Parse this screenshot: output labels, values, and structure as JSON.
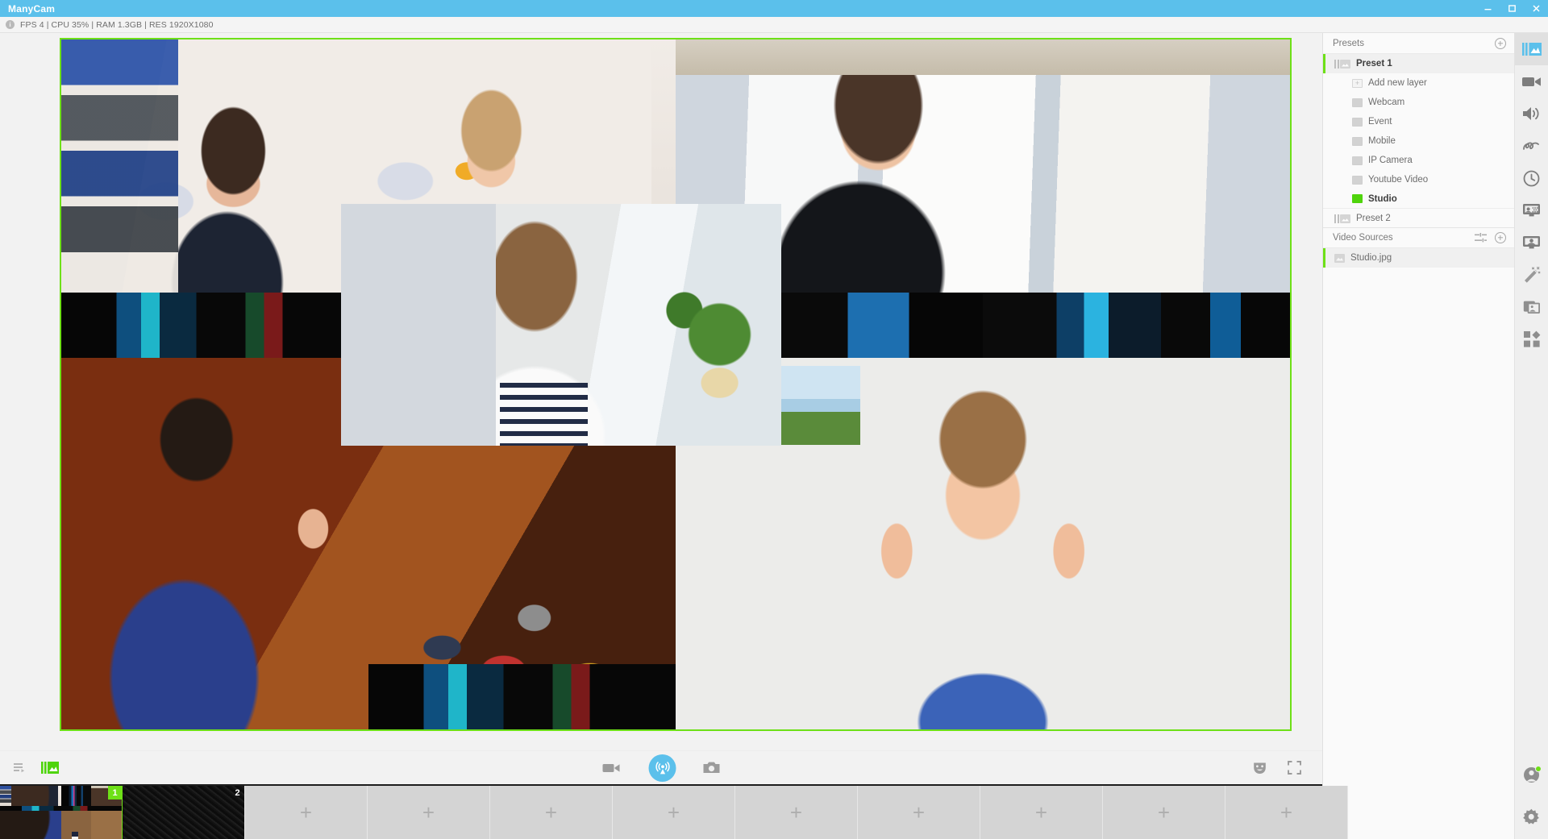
{
  "window": {
    "title": "ManyCam",
    "minimize_label": "–",
    "maximize_label": "☐",
    "close_label": "✕"
  },
  "status": {
    "info_glyph": "i",
    "text": "FPS 4 | CPU 35% | RAM 1.3GB | RES 1920X1080",
    "fps": "4",
    "cpu": "35%",
    "ram": "1.3GB",
    "resolution": "1920X1080"
  },
  "stage": {
    "border_color": "#6ee017",
    "layout": "studio-collage"
  },
  "toolbar": {
    "playlist_label": "Playlist",
    "presets_label": "Presets",
    "record_label": "Record",
    "broadcast_label": "Broadcast",
    "snapshot_label": "Snapshot",
    "effects_label": "Effects",
    "fullscreen_label": "Fullscreen",
    "broadcast_color": "#5bc0eb"
  },
  "thumbstrip": {
    "items": [
      {
        "num": "1",
        "type": "collage",
        "active": true
      },
      {
        "num": "2",
        "type": "noise",
        "active": false
      },
      {
        "num": "",
        "type": "empty",
        "active": false
      },
      {
        "num": "",
        "type": "empty",
        "active": false
      },
      {
        "num": "",
        "type": "empty",
        "active": false
      },
      {
        "num": "",
        "type": "empty",
        "active": false
      },
      {
        "num": "",
        "type": "empty",
        "active": false
      },
      {
        "num": "",
        "type": "empty",
        "active": false
      },
      {
        "num": "",
        "type": "empty",
        "active": false
      },
      {
        "num": "",
        "type": "empty",
        "active": false
      }
    ],
    "plus_label": "+",
    "scroll_next_label": "›"
  },
  "presets": {
    "header": "Presets",
    "add_label": "+",
    "items": [
      {
        "label": "Preset 1",
        "type": "preset",
        "selected": true,
        "bold": true
      },
      {
        "label": "Add new layer",
        "type": "add-layer",
        "selected": false
      },
      {
        "label": "Webcam",
        "type": "layer",
        "selected": false
      },
      {
        "label": "Event",
        "type": "layer",
        "selected": false
      },
      {
        "label": "Mobile",
        "type": "layer",
        "selected": false
      },
      {
        "label": "IP Camera",
        "type": "layer",
        "selected": false
      },
      {
        "label": "Youtube Video",
        "type": "layer",
        "selected": false
      },
      {
        "label": "Studio",
        "type": "layer-active",
        "selected": false,
        "bold": true
      },
      {
        "label": "Preset 2",
        "type": "preset",
        "selected": false
      }
    ]
  },
  "video_sources": {
    "header": "Video Sources",
    "settings_label": "Settings",
    "add_label": "+",
    "items": [
      {
        "label": "Studio.jpg",
        "selected": true
      }
    ]
  },
  "rail": {
    "items": [
      {
        "name": "presets-icon",
        "label": "Presets",
        "active": true
      },
      {
        "name": "video-icon",
        "label": "Video Sources",
        "active": false
      },
      {
        "name": "audio-icon",
        "label": "Audio",
        "active": false
      },
      {
        "name": "draw-icon",
        "label": "Draw",
        "active": false
      },
      {
        "name": "schedule-icon",
        "label": "Scheduler",
        "active": false
      },
      {
        "name": "chroma-key-icon",
        "label": "Chroma Key",
        "active": false
      },
      {
        "name": "background-icon",
        "label": "Backgrounds",
        "active": false
      },
      {
        "name": "effects-icon",
        "label": "Effects",
        "active": false
      },
      {
        "name": "media-icon",
        "label": "Media",
        "active": false
      },
      {
        "name": "apps-icon",
        "label": "Apps",
        "active": false
      }
    ],
    "bottom": [
      {
        "name": "account-icon",
        "label": "Account",
        "status_color": "#6ee017"
      },
      {
        "name": "gear-icon",
        "label": "Settings"
      }
    ]
  }
}
